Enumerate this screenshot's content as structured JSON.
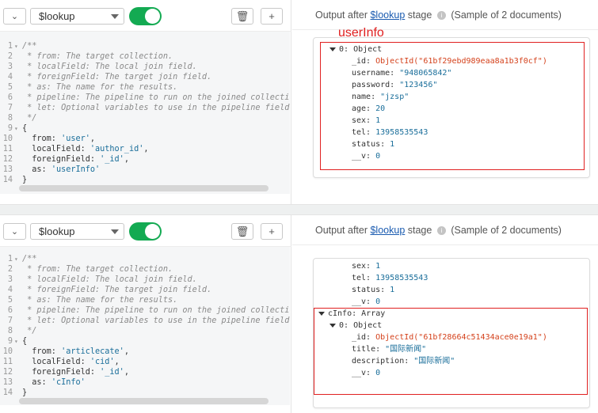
{
  "stages": [
    {
      "operator": "$lookup",
      "code_lines": [
        {
          "n": "1",
          "fold": "▾",
          "text": "/**",
          "type": "comment"
        },
        {
          "n": "2",
          "fold": "",
          "text": " * from: The target collection.",
          "type": "comment"
        },
        {
          "n": "3",
          "fold": "",
          "text": " * localField: The local join field.",
          "type": "comment"
        },
        {
          "n": "4",
          "fold": "",
          "text": " * foreignField: The target join field.",
          "type": "comment"
        },
        {
          "n": "5",
          "fold": "",
          "text": " * as: The name for the results.",
          "type": "comment"
        },
        {
          "n": "6",
          "fold": "",
          "text": " * pipeline: The pipeline to run on the joined collectio",
          "type": "comment"
        },
        {
          "n": "7",
          "fold": "",
          "text": " * let: Optional variables to use in the pipeline field",
          "type": "comment"
        },
        {
          "n": "8",
          "fold": "",
          "text": " */",
          "type": "comment"
        },
        {
          "n": "9",
          "fold": "▾",
          "text": "{",
          "type": "plain"
        },
        {
          "n": "10",
          "fold": "",
          "key": "  from: ",
          "val": "'user'",
          "tail": ",",
          "type": "kv"
        },
        {
          "n": "11",
          "fold": "",
          "key": "  localField: ",
          "val": "'author_id'",
          "tail": ",",
          "type": "kv"
        },
        {
          "n": "12",
          "fold": "",
          "key": "  foreignField: ",
          "val": "'_id'",
          "tail": ",",
          "type": "kv"
        },
        {
          "n": "13",
          "fold": "",
          "key": "  as: ",
          "val": "'userInfo'",
          "tail": "",
          "type": "kv"
        },
        {
          "n": "14",
          "fold": "",
          "text": "}",
          "type": "plain"
        }
      ],
      "output": {
        "prefix": "Output after ",
        "link": "$lookup",
        "suffix": " stage",
        "sample": "(Sample of 2 documents)"
      },
      "doc_fields": [
        {
          "indent": 0,
          "tri": true,
          "key": "0: ",
          "val": "Object",
          "cls": "k"
        },
        {
          "indent": 1,
          "key": "_id: ",
          "val": "ObjectId(\"61bf29ebd989eaa8a1b3f0cf\")",
          "cls": "oid"
        },
        {
          "indent": 1,
          "key": "username: ",
          "val": "\"948065842\"",
          "cls": "s"
        },
        {
          "indent": 1,
          "key": "password: ",
          "val": "\"123456\"",
          "cls": "s"
        },
        {
          "indent": 1,
          "key": "name: ",
          "val": "\"jzsp\"",
          "cls": "s"
        },
        {
          "indent": 1,
          "key": "age: ",
          "val": "20",
          "cls": "n"
        },
        {
          "indent": 1,
          "key": "sex: ",
          "val": "1",
          "cls": "n"
        },
        {
          "indent": 1,
          "key": "tel: ",
          "val": "13958535543",
          "cls": "n"
        },
        {
          "indent": 1,
          "key": "status: ",
          "val": "1",
          "cls": "n"
        },
        {
          "indent": 1,
          "key": "__v: ",
          "val": "0",
          "cls": "n"
        }
      ],
      "annotation": "userInfo"
    },
    {
      "operator": "$lookup",
      "code_lines": [
        {
          "n": "1",
          "fold": "▾",
          "text": "/**",
          "type": "comment"
        },
        {
          "n": "2",
          "fold": "",
          "text": " * from: The target collection.",
          "type": "comment"
        },
        {
          "n": "3",
          "fold": "",
          "text": " * localField: The local join field.",
          "type": "comment"
        },
        {
          "n": "4",
          "fold": "",
          "text": " * foreignField: The target join field.",
          "type": "comment"
        },
        {
          "n": "5",
          "fold": "",
          "text": " * as: The name for the results.",
          "type": "comment"
        },
        {
          "n": "6",
          "fold": "",
          "text": " * pipeline: The pipeline to run on the joined collectio",
          "type": "comment"
        },
        {
          "n": "7",
          "fold": "",
          "text": " * let: Optional variables to use in the pipeline field",
          "type": "comment"
        },
        {
          "n": "8",
          "fold": "",
          "text": " */",
          "type": "comment"
        },
        {
          "n": "9",
          "fold": "▾",
          "text": "{",
          "type": "plain"
        },
        {
          "n": "10",
          "fold": "",
          "key": "  from: ",
          "val": "'articlecate'",
          "tail": ",",
          "type": "kv"
        },
        {
          "n": "11",
          "fold": "",
          "key": "  localField: ",
          "val": "'cid'",
          "tail": ",",
          "type": "kv"
        },
        {
          "n": "12",
          "fold": "",
          "key": "  foreignField: ",
          "val": "'_id'",
          "tail": ",",
          "type": "kv"
        },
        {
          "n": "13",
          "fold": "",
          "key": "  as: ",
          "val": "'cInfo'",
          "tail": "",
          "type": "kv"
        },
        {
          "n": "14",
          "fold": "",
          "text": "}",
          "type": "plain"
        }
      ],
      "output": {
        "prefix": "Output after ",
        "link": "$lookup",
        "suffix": " stage",
        "sample": "(Sample of 2 documents)"
      },
      "doc_fields": [
        {
          "indent": 1,
          "key": "sex: ",
          "val": "1",
          "cls": "n"
        },
        {
          "indent": 1,
          "key": "tel: ",
          "val": "13958535543",
          "cls": "n"
        },
        {
          "indent": 1,
          "key": "status: ",
          "val": "1",
          "cls": "n"
        },
        {
          "indent": 1,
          "key": "__v: ",
          "val": "0",
          "cls": "n"
        },
        {
          "indent": -1,
          "tri": true,
          "key": "cInfo: ",
          "val": "Array",
          "cls": "k"
        },
        {
          "indent": 0,
          "tri": true,
          "key": "0: ",
          "val": "Object",
          "cls": "k"
        },
        {
          "indent": 1,
          "key": "_id: ",
          "val": "ObjectId(\"61bf28664c51434ace0e19a1\")",
          "cls": "oid"
        },
        {
          "indent": 1,
          "key": "title: ",
          "val": "\"国际新闻\"",
          "cls": "s"
        },
        {
          "indent": 1,
          "key": "description: ",
          "val": "\"国际新闻\"",
          "cls": "s"
        },
        {
          "indent": 1,
          "key": "__v: ",
          "val": "0",
          "cls": "n"
        }
      ],
      "annotation": ""
    }
  ],
  "icons": {
    "collapse": "chevron-down-icon",
    "trash": "trash-icon",
    "plus": "plus-icon",
    "info": "info-icon"
  },
  "colors": {
    "toggle_on": "#13aa52",
    "annotation": "#e02020",
    "object_id": "#d4411b",
    "string": "#1a6e9a"
  }
}
